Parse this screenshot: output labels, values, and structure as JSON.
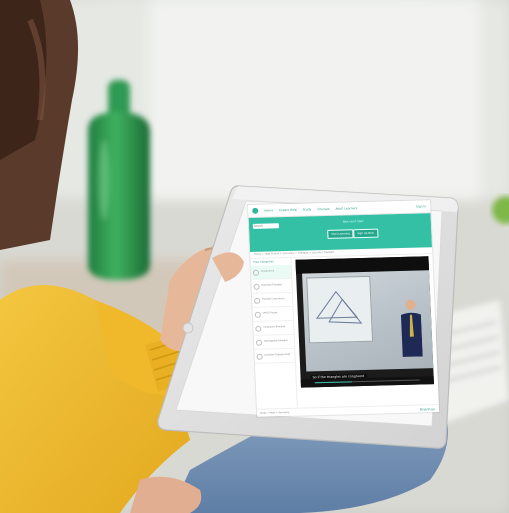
{
  "photo": {
    "description_icons": [
      "green-bottle",
      "tablet-device",
      "person-hand",
      "yellow-sweater",
      "jeans",
      "book"
    ]
  },
  "screen": {
    "nav": {
      "items": [
        "Home",
        "Expert Help",
        "Study",
        "Courses",
        "Adult Learners"
      ],
      "right_label": "Sign In"
    },
    "search": {
      "placeholder": "Search"
    },
    "hero": {
      "prompt": "New user? Start",
      "button_primary": "Start Learning",
      "button_secondary": "Sign Up Now"
    },
    "breadcrumbs": "Home > High School > Geometry > Triangles > Isosceles Triangles",
    "lessons_title": "Play Categories",
    "lessons": [
      {
        "label": "Congruence",
        "active": true
      },
      {
        "label": "Isosceles Triangles",
        "active": false
      },
      {
        "label": "Triangle Congruence",
        "active": false
      },
      {
        "label": "CPCTC Proofs",
        "active": false
      },
      {
        "label": "Congruent Triangles",
        "active": false
      },
      {
        "label": "Overlapping Triangles",
        "active": false
      },
      {
        "label": "Isosceles Triangle Proof",
        "active": false
      }
    ],
    "video": {
      "subtitle": "So if the triangles are congruent",
      "progress": 0.35
    },
    "footer_text": "Study > Math > Geometry",
    "brand": "Brainfuse",
    "colors": {
      "accent": "#34c0a5",
      "accent_dark": "#27a88e"
    }
  }
}
